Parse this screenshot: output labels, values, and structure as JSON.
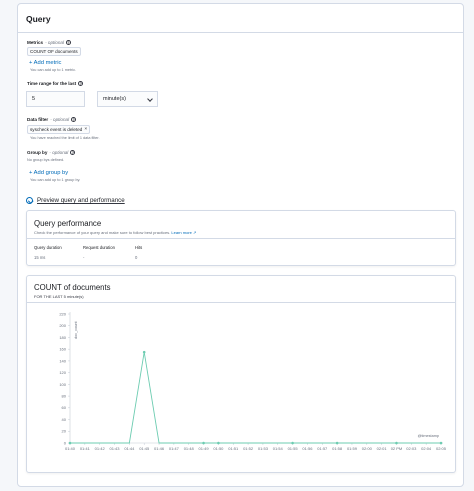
{
  "panel": {
    "title": "Query"
  },
  "metrics": {
    "label": "Metrics",
    "optional": "- optional",
    "selected": "COUNT OF documents",
    "add_link": "+ Add metric",
    "help": "You can add up to 1 metric."
  },
  "time_range": {
    "label": "Time range for the last",
    "value": "5",
    "unit": "minute(s)"
  },
  "data_filter": {
    "label": "Data filter",
    "optional": "- optional",
    "filter": "syscheck event is deleted",
    "help": "You have reached the limit of 1 data filter."
  },
  "group_by": {
    "label": "Group by",
    "optional": "- optional",
    "none_text": "No group bys defined.",
    "add_link": "+ Add group by",
    "help": "You can add up to 1 group by."
  },
  "preview": {
    "label": "Preview query and performance"
  },
  "performance": {
    "title": "Query performance",
    "subtitle": "Check the performance of your query and make sure to follow best practices.",
    "learn_more": "Learn more",
    "stats": [
      {
        "title": "Query duration",
        "value": "15 ms"
      },
      {
        "title": "Request duration",
        "value": "-"
      },
      {
        "title": "Hits",
        "value": "0"
      }
    ]
  },
  "colors": {
    "line": "#6dccb1",
    "accent": "#006bb8"
  },
  "chart_data": {
    "type": "line",
    "title": "COUNT of documents",
    "subtitle": "FOR THE LAST 5 minute(s)",
    "ylabel": "doc_count",
    "xlabel": "@timestamp",
    "ylim": [
      0,
      220
    ],
    "yticks": [
      0,
      20,
      40,
      60,
      80,
      100,
      120,
      140,
      160,
      180,
      200,
      220
    ],
    "categories": [
      "01:40",
      "01:41",
      "01:42",
      "01:43",
      "01:44",
      "01:45",
      "01:46",
      "01:47",
      "01:48",
      "01:49",
      "01:50",
      "01:51",
      "01:52",
      "01:53",
      "01:54",
      "01:55",
      "01:56",
      "01:57",
      "01:58",
      "01:59",
      "02:00",
      "02:01",
      "02 PM",
      "02:03",
      "02:04",
      "02:05"
    ],
    "values": [
      0,
      0,
      0,
      0,
      0,
      155,
      0,
      0,
      0,
      0,
      0,
      0,
      0,
      0,
      0,
      0,
      0,
      0,
      0,
      0,
      0,
      0,
      0,
      0,
      0,
      0
    ],
    "series": [
      {
        "x": [
          "01:40",
          "01:45",
          "01:49",
          "01:50",
          "01:55",
          "01:58",
          "02 PM",
          "02:05"
        ],
        "values": [
          0,
          155,
          0,
          0,
          0,
          0,
          0,
          0
        ]
      }
    ]
  }
}
